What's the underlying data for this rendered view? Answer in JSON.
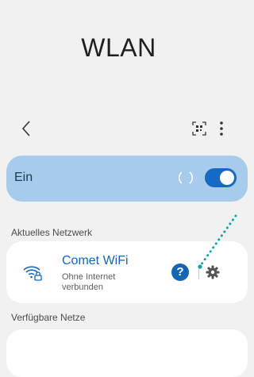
{
  "header": {
    "title": "WLAN"
  },
  "toolbar": {
    "back_icon": "chevron-left-icon",
    "qr_icon": "qr-code-icon",
    "more_icon": "more-vertical-icon"
  },
  "wifi_toggle": {
    "label": "Ein",
    "state": "on",
    "accent": "#1769c4",
    "card_color": "#a6cbeb"
  },
  "current_network": {
    "section_label": "Aktuelles Netzwerk",
    "name": "Comet WiFi",
    "status": "Ohne Internet verbunden",
    "icon": "wifi-lock-icon",
    "help_icon": "help-icon",
    "help_symbol": "?",
    "settings_icon": "gear-icon"
  },
  "available_networks": {
    "section_label": "Verfügbare Netze"
  },
  "annotation": {
    "color": "#12a5a0"
  }
}
